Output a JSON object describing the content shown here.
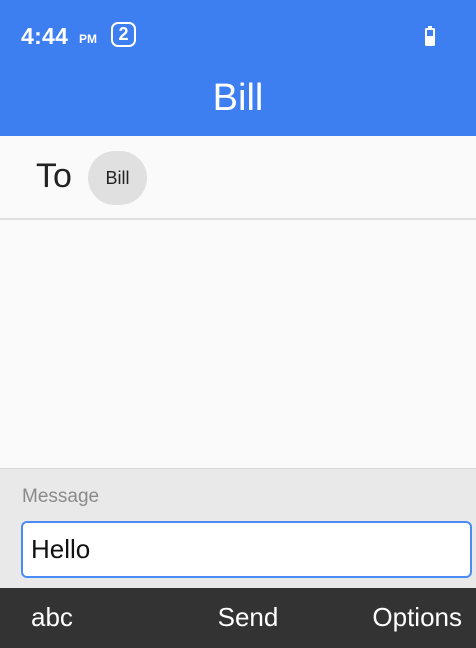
{
  "status_bar": {
    "time": "4:44",
    "ampm": "PM",
    "notification_count": "2"
  },
  "header": {
    "title": "Bill"
  },
  "recipient": {
    "to_label": "To",
    "chip_label": "Bill"
  },
  "compose": {
    "label": "Message",
    "value": "Hello"
  },
  "softkeys": {
    "left": "abc",
    "center": "Send",
    "right": "Options"
  },
  "colors": {
    "header_bg": "#3d7ef1",
    "input_border": "#4a8cf4",
    "softkey_bg": "#333333"
  },
  "icons": {
    "battery": "battery-icon"
  }
}
